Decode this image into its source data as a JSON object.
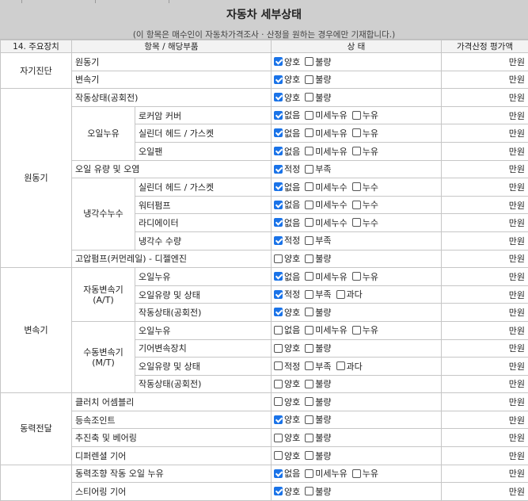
{
  "header": {
    "title": "자동차 세부상태",
    "notice": "(이 항목은 매수인이 자동차가격조사 · 산정을 원하는 경우에만 기재합니다.)"
  },
  "columns": {
    "main": "14. 주요장치",
    "item": "항목 / 해당부품",
    "status": "상 태",
    "price": "가격산정 평가액"
  },
  "rows": [
    {
      "cat": "자기진단",
      "sub": "",
      "item": "원동기",
      "status": [
        {
          "label": "양호",
          "checked": true
        },
        {
          "label": "불량",
          "checked": false
        }
      ],
      "price": "만원"
    },
    {
      "cat": "자기진단",
      "sub": "",
      "item": "변속기",
      "status": [
        {
          "label": "양호",
          "checked": true
        },
        {
          "label": "불량",
          "checked": false
        }
      ],
      "price": "만원"
    },
    {
      "cat": "원동기",
      "sub": "",
      "item": "작동상태(공회전)",
      "status": [
        {
          "label": "양호",
          "checked": true
        },
        {
          "label": "불량",
          "checked": false
        }
      ],
      "price": "만원"
    },
    {
      "cat": "원동기",
      "sub": "오일누유",
      "item": "로커암 커버",
      "status": [
        {
          "label": "없음",
          "checked": true
        },
        {
          "label": "미세누유",
          "checked": false
        },
        {
          "label": "누유",
          "checked": false
        }
      ],
      "price": "만원"
    },
    {
      "cat": "원동기",
      "sub": "오일누유",
      "item": "실린더 헤드 / 가스켓",
      "status": [
        {
          "label": "없음",
          "checked": true
        },
        {
          "label": "미세누유",
          "checked": false
        },
        {
          "label": "누유",
          "checked": false
        }
      ],
      "price": "만원"
    },
    {
      "cat": "원동기",
      "sub": "오일누유",
      "item": "오일팬",
      "status": [
        {
          "label": "없음",
          "checked": true
        },
        {
          "label": "미세누유",
          "checked": false
        },
        {
          "label": "누유",
          "checked": false
        }
      ],
      "price": "만원"
    },
    {
      "cat": "원동기",
      "sub": "",
      "item": "오일 유량 및 오염",
      "status": [
        {
          "label": "적정",
          "checked": true
        },
        {
          "label": "부족",
          "checked": false
        }
      ],
      "price": "만원"
    },
    {
      "cat": "원동기",
      "sub": "냉각수누수",
      "item": "실린더 헤드 / 가스켓",
      "status": [
        {
          "label": "없음",
          "checked": true
        },
        {
          "label": "미세누수",
          "checked": false
        },
        {
          "label": "누수",
          "checked": false
        }
      ],
      "price": "만원"
    },
    {
      "cat": "원동기",
      "sub": "냉각수누수",
      "item": "워터펌프",
      "status": [
        {
          "label": "없음",
          "checked": true
        },
        {
          "label": "미세누수",
          "checked": false
        },
        {
          "label": "누수",
          "checked": false
        }
      ],
      "price": "만원"
    },
    {
      "cat": "원동기",
      "sub": "냉각수누수",
      "item": "라디에이터",
      "status": [
        {
          "label": "없음",
          "checked": true
        },
        {
          "label": "미세누수",
          "checked": false
        },
        {
          "label": "누수",
          "checked": false
        }
      ],
      "price": "만원"
    },
    {
      "cat": "원동기",
      "sub": "냉각수누수",
      "item": "냉각수 수량",
      "status": [
        {
          "label": "적정",
          "checked": true
        },
        {
          "label": "부족",
          "checked": false
        }
      ],
      "price": "만원"
    },
    {
      "cat": "원동기",
      "sub": "",
      "item": "고압펌프(커먼레일) - 디젤엔진",
      "status": [
        {
          "label": "양호",
          "checked": false
        },
        {
          "label": "불량",
          "checked": false
        }
      ],
      "price": "만원"
    },
    {
      "cat": "변속기",
      "sub": "자동변속기 (A/T)",
      "item": "오일누유",
      "status": [
        {
          "label": "없음",
          "checked": true
        },
        {
          "label": "미세누유",
          "checked": false
        },
        {
          "label": "누유",
          "checked": false
        }
      ],
      "price": "만원"
    },
    {
      "cat": "변속기",
      "sub": "자동변속기 (A/T)",
      "item": "오일유량 및 상태",
      "status": [
        {
          "label": "적정",
          "checked": true
        },
        {
          "label": "부족",
          "checked": false
        },
        {
          "label": "과다",
          "checked": false
        }
      ],
      "price": "만원"
    },
    {
      "cat": "변속기",
      "sub": "자동변속기 (A/T)",
      "item": "작동상태(공회전)",
      "status": [
        {
          "label": "양호",
          "checked": true
        },
        {
          "label": "불량",
          "checked": false
        }
      ],
      "price": "만원"
    },
    {
      "cat": "변속기",
      "sub": "수동변속기 (M/T)",
      "item": "오일누유",
      "status": [
        {
          "label": "없음",
          "checked": false
        },
        {
          "label": "미세누유",
          "checked": false
        },
        {
          "label": "누유",
          "checked": false
        }
      ],
      "price": "만원"
    },
    {
      "cat": "변속기",
      "sub": "수동변속기 (M/T)",
      "item": "기어변속장치",
      "status": [
        {
          "label": "양호",
          "checked": false
        },
        {
          "label": "불량",
          "checked": false
        }
      ],
      "price": "만원"
    },
    {
      "cat": "변속기",
      "sub": "수동변속기 (M/T)",
      "item": "오일유량 및 상태",
      "status": [
        {
          "label": "적정",
          "checked": false
        },
        {
          "label": "부족",
          "checked": false
        },
        {
          "label": "과다",
          "checked": false
        }
      ],
      "price": "만원"
    },
    {
      "cat": "변속기",
      "sub": "수동변속기 (M/T)",
      "item": "작동상태(공회전)",
      "status": [
        {
          "label": "양호",
          "checked": false
        },
        {
          "label": "불량",
          "checked": false
        }
      ],
      "price": "만원"
    },
    {
      "cat": "동력전달",
      "sub": "",
      "item": "클러치 어셈블리",
      "status": [
        {
          "label": "양호",
          "checked": false
        },
        {
          "label": "불량",
          "checked": false
        }
      ],
      "price": "만원"
    },
    {
      "cat": "동력전달",
      "sub": "",
      "item": "등속조인트",
      "status": [
        {
          "label": "양호",
          "checked": true
        },
        {
          "label": "불량",
          "checked": false
        }
      ],
      "price": "만원"
    },
    {
      "cat": "동력전달",
      "sub": "",
      "item": "추진축 및 베어링",
      "status": [
        {
          "label": "양호",
          "checked": false
        },
        {
          "label": "불량",
          "checked": false
        }
      ],
      "price": "만원"
    },
    {
      "cat": "동력전달",
      "sub": "",
      "item": "디퍼렌셜 기어",
      "status": [
        {
          "label": "양호",
          "checked": false
        },
        {
          "label": "불량",
          "checked": false
        }
      ],
      "price": "만원"
    },
    {
      "cat": "",
      "sub": "",
      "item": "동력조향 작동 오일 누유",
      "status": [
        {
          "label": "없음",
          "checked": true
        },
        {
          "label": "미세누유",
          "checked": false
        },
        {
          "label": "누유",
          "checked": false
        }
      ],
      "price": "만원"
    },
    {
      "cat": "",
      "sub": "",
      "item": "스티어링 기어",
      "status": [
        {
          "label": "양호",
          "checked": true
        },
        {
          "label": "불량",
          "checked": false
        }
      ],
      "price": "만원"
    }
  ],
  "colors": {
    "header_bg": "#cfcfcf",
    "checkbox_on": "#1a73e8"
  }
}
